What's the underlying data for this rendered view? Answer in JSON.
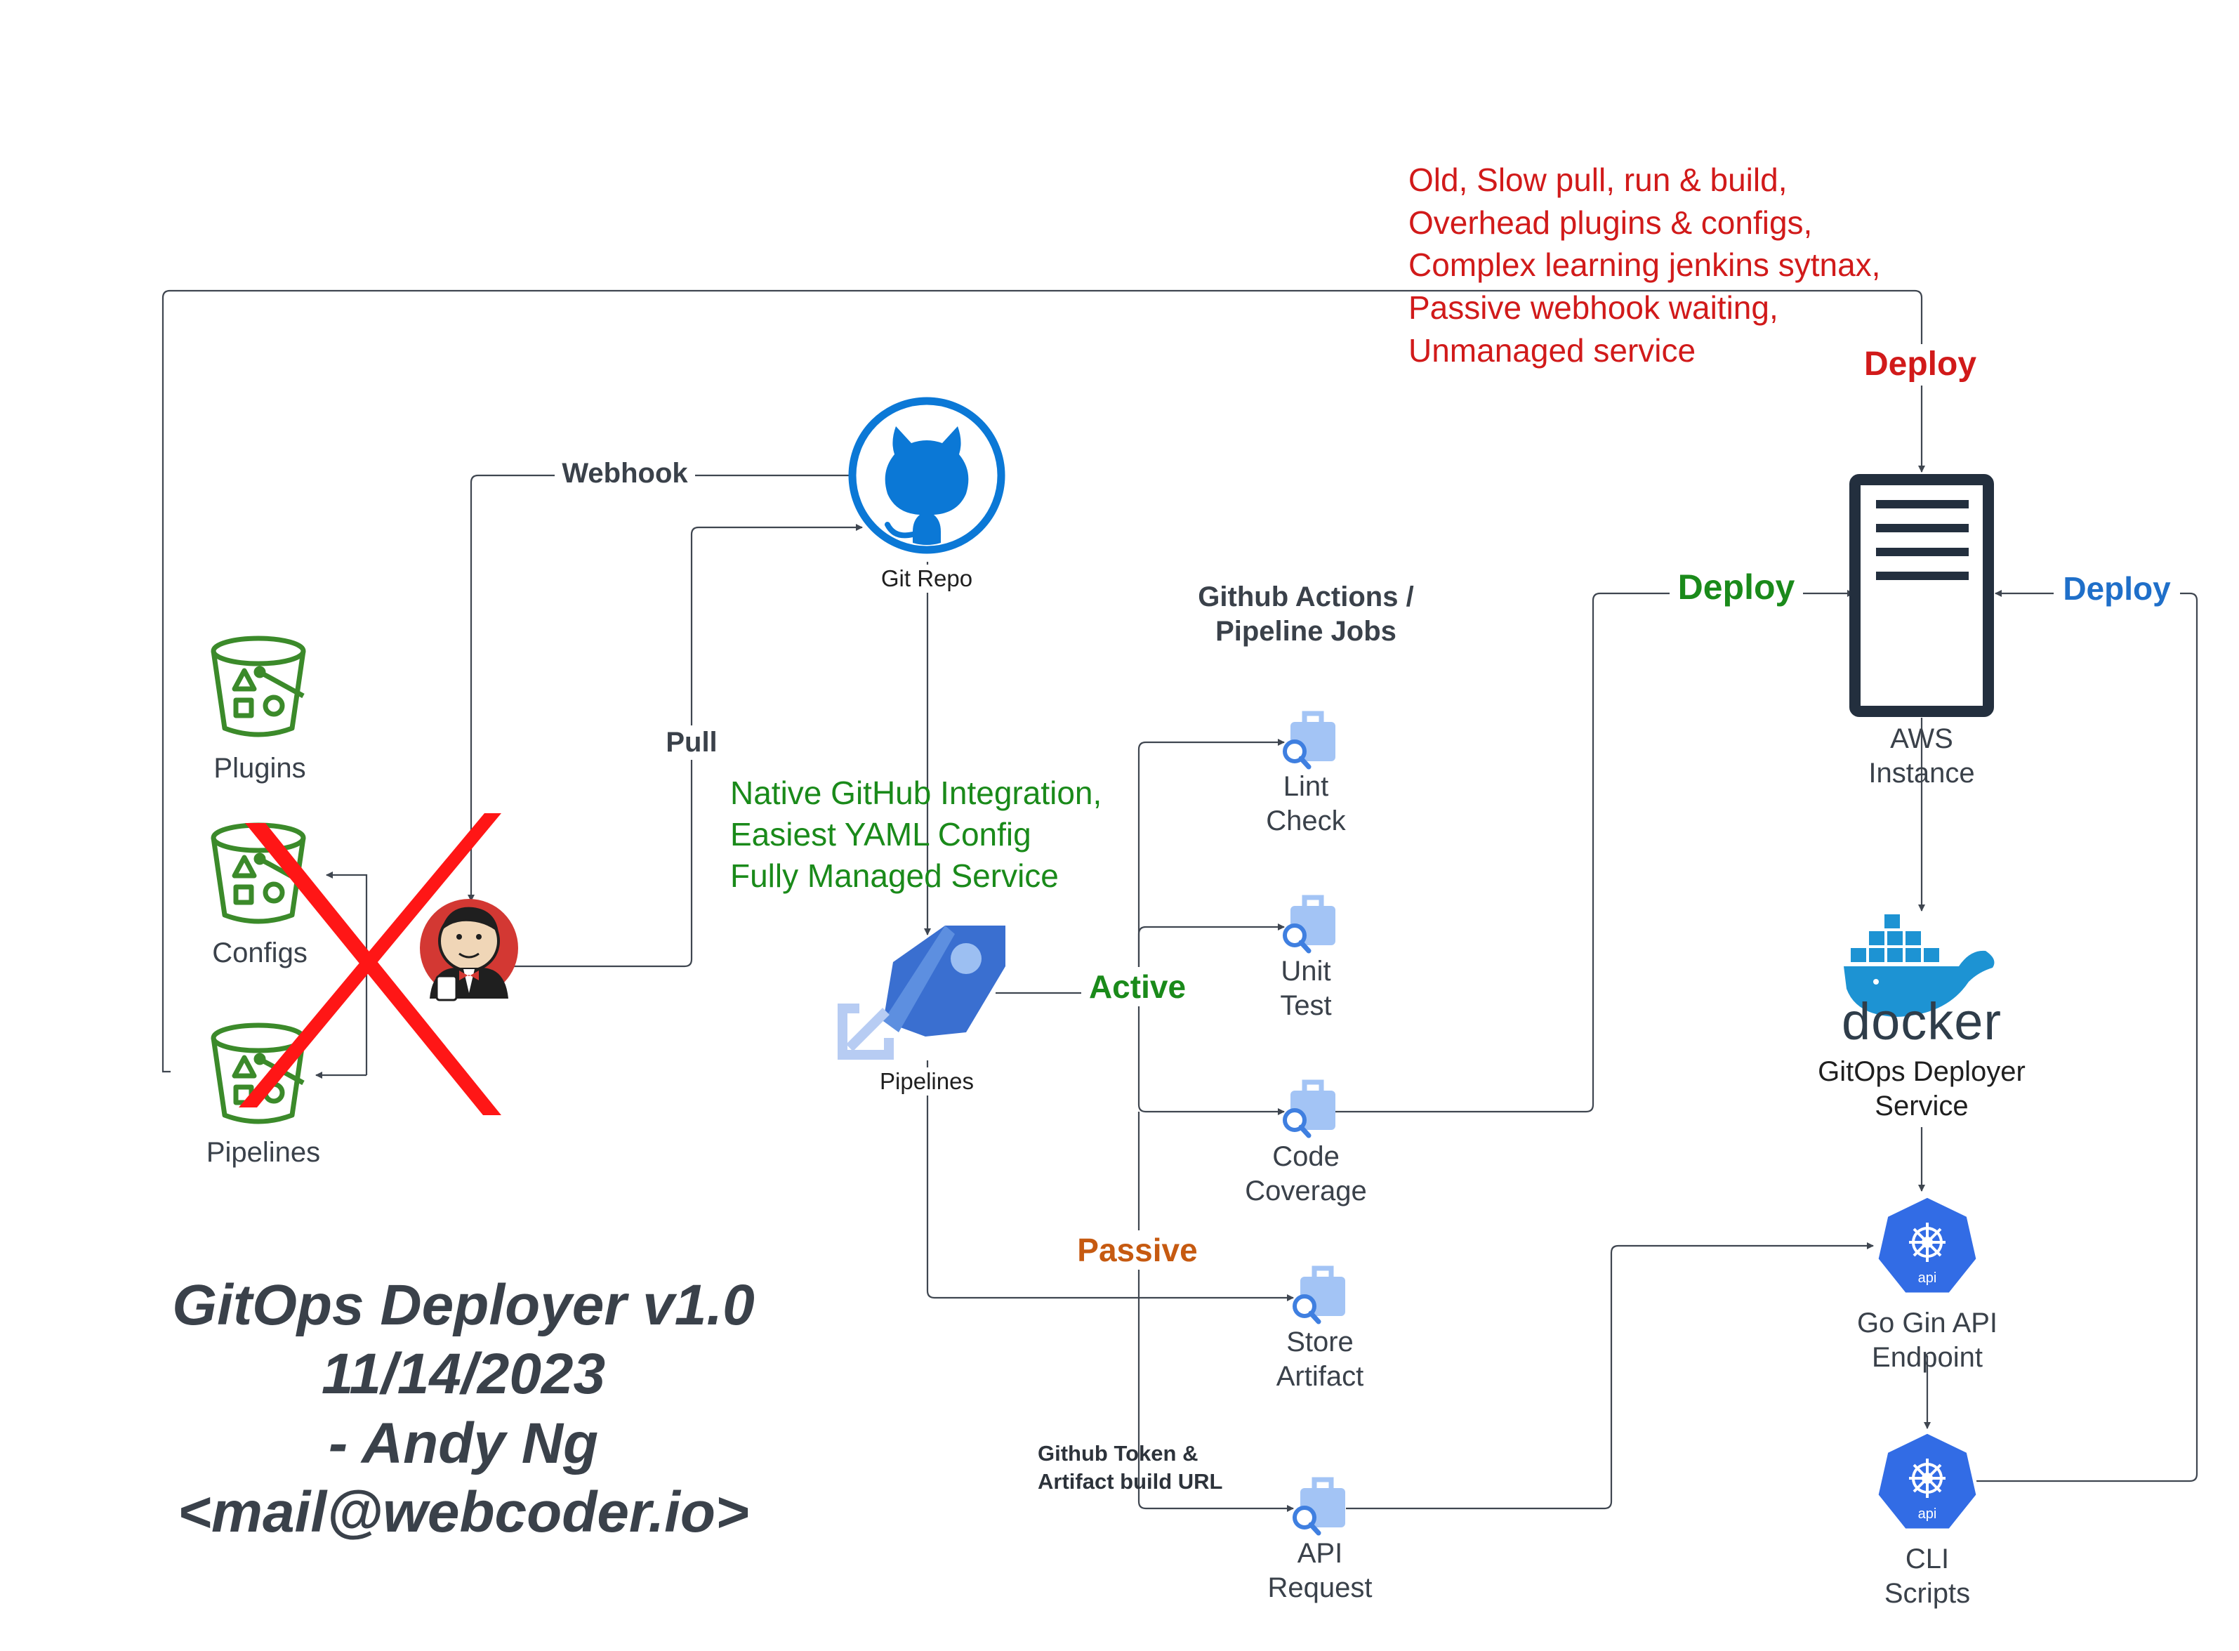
{
  "colors": {
    "line": "#3f4650",
    "red_note": "#d11a1a",
    "green_note": "#1a8a1a",
    "blue_deploy": "#1f6fc9",
    "orange_passive": "#c65a11",
    "bucket_green": "#3b8a2a",
    "github_blue": "#0b78d6",
    "azure_blue": "#3a6fd0",
    "k8s_blue": "#326ce5",
    "docker_blue": "#1d93d3",
    "server_dark": "#232f3e",
    "cross_red": "#ff1616"
  },
  "legacy": {
    "plugins_label": "Plugins",
    "configs_label": "Configs",
    "pipelines_label": "Pipelines",
    "bucket_icon": "storage-bucket-icon",
    "jenkins_icon": "jenkins-butler-icon",
    "cross_icon": "red-x-icon"
  },
  "edges": {
    "webhook": "Webhook",
    "pull": "Pull",
    "active": "Active",
    "passive": "Passive",
    "deploy_red": "Deploy",
    "deploy_green": "Deploy",
    "deploy_blue": "Deploy",
    "token_note": "Github Token &\nArtifact build URL"
  },
  "github": {
    "label": "Git Repo",
    "icon": "github-octocat-icon"
  },
  "azure": {
    "label": "Pipelines",
    "icon": "azure-pipelines-icon"
  },
  "jobs": {
    "title": "Github Actions /\nPipeline Jobs",
    "icon": "briefcase-search-icon",
    "lint": "Lint\nCheck",
    "unit": "Unit\nTest",
    "coverage": "Code\nCoverage",
    "store": "Store\nArtifact",
    "api": "API\nRequest"
  },
  "aws": {
    "label": "AWS\nInstance",
    "icon": "server-icon"
  },
  "docker": {
    "wordmark": "docker",
    "label": "GitOps Deployer\nService",
    "icon": "docker-whale-icon"
  },
  "k8s": {
    "badge": "api",
    "gin_label": "Go Gin API\nEndpoint",
    "cli_label": "CLI\nScripts",
    "icon": "kubernetes-api-icon"
  },
  "notes": {
    "old_issues": "Old, Slow pull, run & build,\nOverhead plugins & configs,\nComplex learning jenkins sytnax,\nPassive webhook waiting,\nUnmanaged service",
    "new_benefits": "Native GitHub Integration,\nEasiest YAML Config\nFully Managed Service"
  },
  "footer": {
    "title": "GitOps Deployer v1.0\n11/14/2023\n- Andy Ng\n<mail@webcoder.io>"
  }
}
